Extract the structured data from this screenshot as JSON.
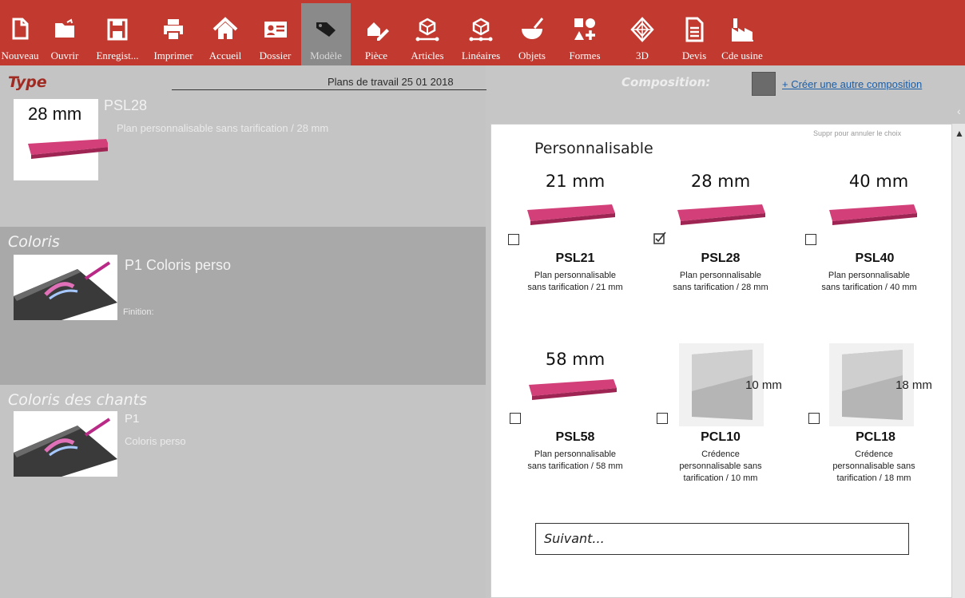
{
  "colors": {
    "toolbar": "#c1392f",
    "active_tab": "#8a8a8a",
    "accent_title": "#a02b22",
    "link": "#1a5ea8",
    "slab": "#c8376a"
  },
  "toolbar": [
    {
      "id": "nouveau",
      "label": "Nouveau",
      "icon": "new-document-icon"
    },
    {
      "id": "ouvrir",
      "label": "Ouvrir",
      "icon": "folder-icon"
    },
    {
      "id": "enregistrer",
      "label": "Enregist...",
      "icon": "save-icon"
    },
    {
      "id": "imprimer",
      "label": "Imprimer",
      "icon": "printer-icon"
    },
    {
      "id": "accueil",
      "label": "Accueil",
      "icon": "home-icon"
    },
    {
      "id": "dossier",
      "label": "Dossier",
      "icon": "id-card-icon"
    },
    {
      "id": "modele",
      "label": "Modèle",
      "icon": "tag-icon",
      "active": true
    },
    {
      "id": "piece",
      "label": "Pièce",
      "icon": "room-pencil-icon"
    },
    {
      "id": "articles",
      "label": "Articles",
      "icon": "box-arrow-icon"
    },
    {
      "id": "lineaires",
      "label": "Linéaires",
      "icon": "linear-box-icon"
    },
    {
      "id": "objets",
      "label": "Objets",
      "icon": "bowl-icon"
    },
    {
      "id": "formes",
      "label": "Formes",
      "icon": "shapes-icon"
    },
    {
      "id": "3d",
      "label": "3D",
      "icon": "cube-3d-icon"
    },
    {
      "id": "devis",
      "label": "Devis",
      "icon": "quote-document-icon"
    },
    {
      "id": "cde_usine",
      "label": "Cde usine",
      "icon": "factory-icon"
    }
  ],
  "type_section": {
    "title": "Type",
    "caption": "Plans de travail 25 01 2018",
    "thumb_mm": "28 mm",
    "code": "PSL28",
    "desc": "Plan personnalisable sans tarification /  28 mm"
  },
  "coloris_section": {
    "title": "Coloris",
    "name": "P1 Coloris perso",
    "finition": "Finition:"
  },
  "chants_section": {
    "title": "Coloris des chants",
    "code": "P1",
    "name": "Coloris perso"
  },
  "composition": {
    "label": "Composition:",
    "link": "+ Créer une autre composition",
    "collapse": "‹"
  },
  "panel": {
    "hint": "Suppr pour annuler le choix",
    "title": "Personnalisable",
    "options": [
      {
        "code": "PSL21",
        "mm": "21 mm",
        "kind": "slab",
        "checked": false,
        "desc1": "Plan personnalisable",
        "desc2": "sans tarification /  21 mm",
        "desc3": ""
      },
      {
        "code": "PSL28",
        "mm": "28 mm",
        "kind": "slab",
        "checked": true,
        "desc1": "Plan personnalisable",
        "desc2": "sans tarification /  28 mm",
        "desc3": ""
      },
      {
        "code": "PSL40",
        "mm": "40 mm",
        "kind": "slab",
        "checked": false,
        "desc1": "Plan personnalisable",
        "desc2": "sans tarification /  40 mm",
        "desc3": ""
      },
      {
        "code": "PSL58",
        "mm": "58 mm",
        "kind": "slab",
        "checked": false,
        "desc1": "Plan personnalisable",
        "desc2": "sans tarification /  58 mm",
        "desc3": ""
      },
      {
        "code": "PCL10",
        "mm": "10 mm",
        "kind": "plate",
        "checked": false,
        "desc1": "Crédence",
        "desc2": "personnalisable sans",
        "desc3": "tarification /  10 mm"
      },
      {
        "code": "PCL18",
        "mm": "18 mm",
        "kind": "plate",
        "checked": false,
        "desc1": "Crédence",
        "desc2": "personnalisable sans",
        "desc3": "tarification /  18 mm"
      }
    ],
    "next": "Suivant..."
  }
}
